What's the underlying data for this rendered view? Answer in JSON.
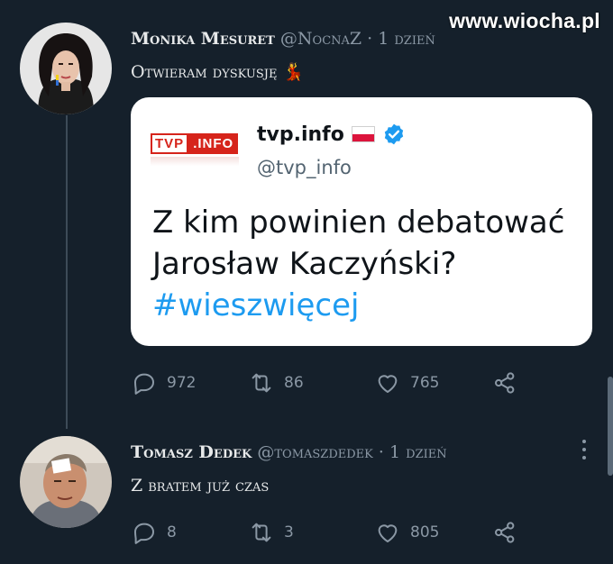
{
  "watermark": "www.wiocha.pl",
  "tweets": [
    {
      "author_name": "Monika Mesuret",
      "author_handle": "@NocnaZ",
      "separator": "·",
      "time": "1 dzień",
      "text": "Otwieram dyskusję 💃",
      "quote": {
        "logo_tvp": "TVP",
        "logo_info": ".INFO",
        "name": "tvp.info",
        "handle": "@tvp_info",
        "text_line1": "Z kim powinien debatować",
        "text_line2": "Jarosław Kaczyński?",
        "hashtag": "#wieszwięcej"
      },
      "replies": "972",
      "retweets": "86",
      "likes": "765"
    },
    {
      "author_name": "Tomasz Dedek",
      "author_handle": "@tomaszdedek",
      "separator": "·",
      "time": "1 dzień",
      "text": "Z bratem już czas",
      "replies": "8",
      "retweets": "3",
      "likes": "805"
    }
  ],
  "colors": {
    "background": "#15202b",
    "muted": "#8b98a5",
    "link": "#1d9bf0",
    "verified": "#1d9bf0",
    "tvp_red": "#d6241b"
  },
  "icons": [
    "reply-icon",
    "retweet-icon",
    "like-icon",
    "share-icon",
    "verified-badge-icon",
    "more-icon"
  ]
}
